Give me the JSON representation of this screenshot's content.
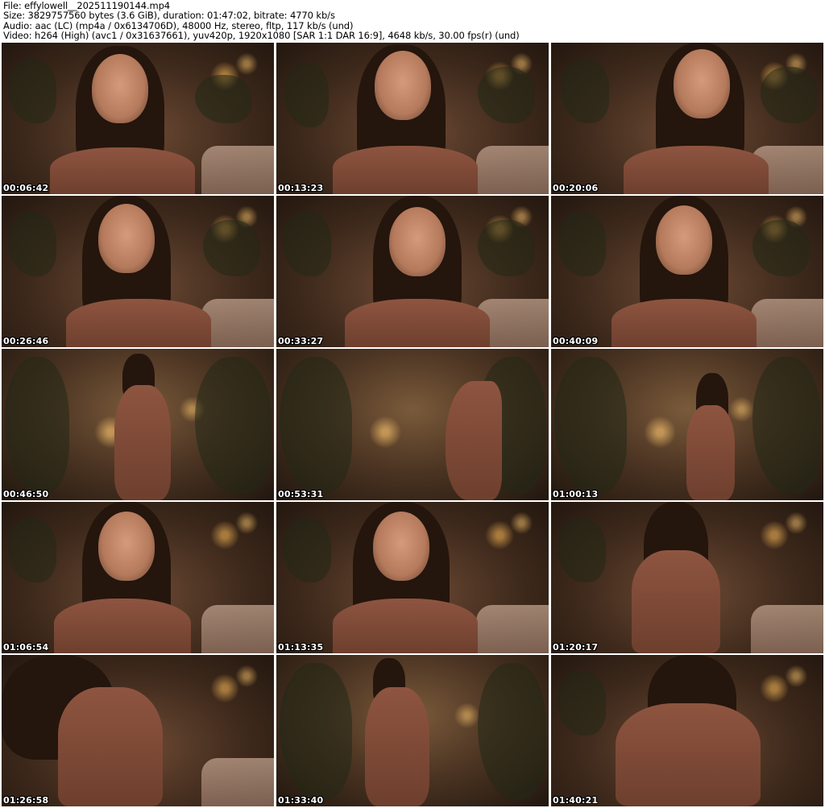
{
  "header": {
    "file_line": "File: effylowell__202511190144.mp4",
    "size_line": "Size: 3829757560 bytes (3.6 GiB), duration: 01:47:02, bitrate: 4770 kb/s",
    "audio_line": "Audio: aac (LC) (mp4a / 0x6134706D), 48000 Hz, stereo, fltp, 117 kb/s (und)",
    "video_line": "Video: h264 (High) (avc1 / 0x31637661), yuv420p, 1920x1080 [SAR 1:1 DAR 16:9], 4648 kb/s, 30.00 fps(r) (und)"
  },
  "thumbnails": [
    {
      "timestamp": "00:06:42"
    },
    {
      "timestamp": "00:13:23"
    },
    {
      "timestamp": "00:20:06"
    },
    {
      "timestamp": "00:26:46"
    },
    {
      "timestamp": "00:33:27"
    },
    {
      "timestamp": "00:40:09"
    },
    {
      "timestamp": "00:46:50"
    },
    {
      "timestamp": "00:53:31"
    },
    {
      "timestamp": "01:00:13"
    },
    {
      "timestamp": "01:06:54"
    },
    {
      "timestamp": "01:13:35"
    },
    {
      "timestamp": "01:20:17"
    },
    {
      "timestamp": "01:26:58"
    },
    {
      "timestamp": "01:33:40"
    },
    {
      "timestamp": "01:40:21"
    }
  ]
}
